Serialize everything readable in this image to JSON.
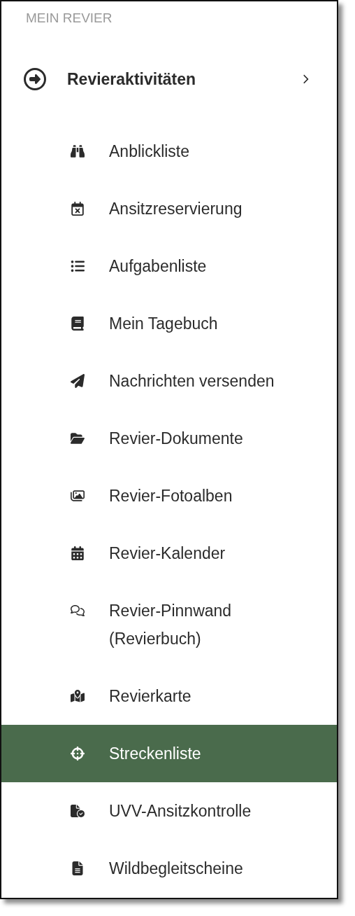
{
  "section_title": "MEIN REVIER",
  "group": {
    "label": "Revieraktivitäten"
  },
  "items": [
    {
      "label": "Anblickliste",
      "selected": false
    },
    {
      "label": "Ansitzreservierung",
      "selected": false
    },
    {
      "label": "Aufgabenliste",
      "selected": false
    },
    {
      "label": "Mein Tagebuch",
      "selected": false
    },
    {
      "label": "Nachrichten versenden",
      "selected": false
    },
    {
      "label": "Revier-Dokumente",
      "selected": false
    },
    {
      "label": "Revier-Fotoalben",
      "selected": false
    },
    {
      "label": "Revier-Kalender",
      "selected": false
    },
    {
      "label": "Revier-Pinnwand (Revierbuch)",
      "selected": false
    },
    {
      "label": "Revierkarte",
      "selected": false
    },
    {
      "label": "Streckenliste",
      "selected": true
    },
    {
      "label": "UVV-Ansitzkontrolle",
      "selected": false
    },
    {
      "label": "Wildbegleitscheine",
      "selected": false
    }
  ]
}
